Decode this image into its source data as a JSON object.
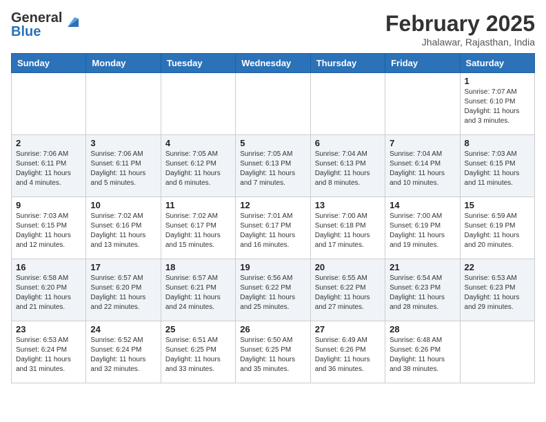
{
  "header": {
    "logo_general": "General",
    "logo_blue": "Blue",
    "month_year": "February 2025",
    "location": "Jhalawar, Rajasthan, India"
  },
  "days_of_week": [
    "Sunday",
    "Monday",
    "Tuesday",
    "Wednesday",
    "Thursday",
    "Friday",
    "Saturday"
  ],
  "weeks": [
    [
      {
        "day": "",
        "info": ""
      },
      {
        "day": "",
        "info": ""
      },
      {
        "day": "",
        "info": ""
      },
      {
        "day": "",
        "info": ""
      },
      {
        "day": "",
        "info": ""
      },
      {
        "day": "",
        "info": ""
      },
      {
        "day": "1",
        "info": "Sunrise: 7:07 AM\nSunset: 6:10 PM\nDaylight: 11 hours\nand 3 minutes."
      }
    ],
    [
      {
        "day": "2",
        "info": "Sunrise: 7:06 AM\nSunset: 6:11 PM\nDaylight: 11 hours\nand 4 minutes."
      },
      {
        "day": "3",
        "info": "Sunrise: 7:06 AM\nSunset: 6:11 PM\nDaylight: 11 hours\nand 5 minutes."
      },
      {
        "day": "4",
        "info": "Sunrise: 7:05 AM\nSunset: 6:12 PM\nDaylight: 11 hours\nand 6 minutes."
      },
      {
        "day": "5",
        "info": "Sunrise: 7:05 AM\nSunset: 6:13 PM\nDaylight: 11 hours\nand 7 minutes."
      },
      {
        "day": "6",
        "info": "Sunrise: 7:04 AM\nSunset: 6:13 PM\nDaylight: 11 hours\nand 8 minutes."
      },
      {
        "day": "7",
        "info": "Sunrise: 7:04 AM\nSunset: 6:14 PM\nDaylight: 11 hours\nand 10 minutes."
      },
      {
        "day": "8",
        "info": "Sunrise: 7:03 AM\nSunset: 6:15 PM\nDaylight: 11 hours\nand 11 minutes."
      }
    ],
    [
      {
        "day": "9",
        "info": "Sunrise: 7:03 AM\nSunset: 6:15 PM\nDaylight: 11 hours\nand 12 minutes."
      },
      {
        "day": "10",
        "info": "Sunrise: 7:02 AM\nSunset: 6:16 PM\nDaylight: 11 hours\nand 13 minutes."
      },
      {
        "day": "11",
        "info": "Sunrise: 7:02 AM\nSunset: 6:17 PM\nDaylight: 11 hours\nand 15 minutes."
      },
      {
        "day": "12",
        "info": "Sunrise: 7:01 AM\nSunset: 6:17 PM\nDaylight: 11 hours\nand 16 minutes."
      },
      {
        "day": "13",
        "info": "Sunrise: 7:00 AM\nSunset: 6:18 PM\nDaylight: 11 hours\nand 17 minutes."
      },
      {
        "day": "14",
        "info": "Sunrise: 7:00 AM\nSunset: 6:19 PM\nDaylight: 11 hours\nand 19 minutes."
      },
      {
        "day": "15",
        "info": "Sunrise: 6:59 AM\nSunset: 6:19 PM\nDaylight: 11 hours\nand 20 minutes."
      }
    ],
    [
      {
        "day": "16",
        "info": "Sunrise: 6:58 AM\nSunset: 6:20 PM\nDaylight: 11 hours\nand 21 minutes."
      },
      {
        "day": "17",
        "info": "Sunrise: 6:57 AM\nSunset: 6:20 PM\nDaylight: 11 hours\nand 22 minutes."
      },
      {
        "day": "18",
        "info": "Sunrise: 6:57 AM\nSunset: 6:21 PM\nDaylight: 11 hours\nand 24 minutes."
      },
      {
        "day": "19",
        "info": "Sunrise: 6:56 AM\nSunset: 6:22 PM\nDaylight: 11 hours\nand 25 minutes."
      },
      {
        "day": "20",
        "info": "Sunrise: 6:55 AM\nSunset: 6:22 PM\nDaylight: 11 hours\nand 27 minutes."
      },
      {
        "day": "21",
        "info": "Sunrise: 6:54 AM\nSunset: 6:23 PM\nDaylight: 11 hours\nand 28 minutes."
      },
      {
        "day": "22",
        "info": "Sunrise: 6:53 AM\nSunset: 6:23 PM\nDaylight: 11 hours\nand 29 minutes."
      }
    ],
    [
      {
        "day": "23",
        "info": "Sunrise: 6:53 AM\nSunset: 6:24 PM\nDaylight: 11 hours\nand 31 minutes."
      },
      {
        "day": "24",
        "info": "Sunrise: 6:52 AM\nSunset: 6:24 PM\nDaylight: 11 hours\nand 32 minutes."
      },
      {
        "day": "25",
        "info": "Sunrise: 6:51 AM\nSunset: 6:25 PM\nDaylight: 11 hours\nand 33 minutes."
      },
      {
        "day": "26",
        "info": "Sunrise: 6:50 AM\nSunset: 6:25 PM\nDaylight: 11 hours\nand 35 minutes."
      },
      {
        "day": "27",
        "info": "Sunrise: 6:49 AM\nSunset: 6:26 PM\nDaylight: 11 hours\nand 36 minutes."
      },
      {
        "day": "28",
        "info": "Sunrise: 6:48 AM\nSunset: 6:26 PM\nDaylight: 11 hours\nand 38 minutes."
      },
      {
        "day": "",
        "info": ""
      }
    ]
  ]
}
